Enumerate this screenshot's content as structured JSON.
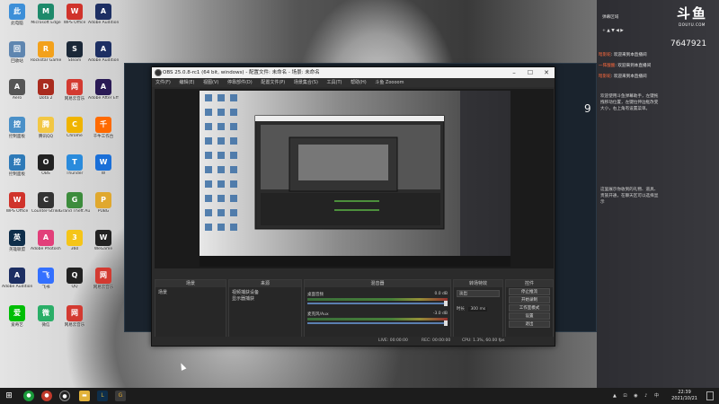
{
  "desktop_icons": [
    {
      "name": "此电脑",
      "icon": "computer-icon",
      "color": "#3d8fd8"
    },
    {
      "name": "Microsoft Edge",
      "icon": "edge-icon",
      "color": "#1e8a6b"
    },
    {
      "name": "WPS Office",
      "icon": "wps-icon",
      "color": "#d0332b"
    },
    {
      "name": "Adobe Audition",
      "icon": "audition-icon",
      "color": "#1d2f63"
    },
    {
      "name": "回收站",
      "icon": "recycle-bin-icon",
      "color": "#5f86b0"
    },
    {
      "name": "Rockstar Games",
      "icon": "rockstar-icon",
      "color": "#f3a11b"
    },
    {
      "name": "Steam",
      "icon": "steam-icon",
      "color": "#1b2838"
    },
    {
      "name": "Adobe Audition",
      "icon": "audition-icon",
      "color": "#1d2f63"
    },
    {
      "name": "Aero",
      "icon": "aero-icon",
      "color": "#555"
    },
    {
      "name": "Dota 2",
      "icon": "dota-icon",
      "color": "#a92b1e"
    },
    {
      "name": "网易云音乐",
      "icon": "music-icon",
      "color": "#d33a31"
    },
    {
      "name": "Adobe After Effects",
      "icon": "ae-icon",
      "color": "#2a1a55"
    },
    {
      "name": "控制面板",
      "icon": "control-panel-icon",
      "color": "#4a90c8"
    },
    {
      "name": "腾讯QQ",
      "icon": "qq-icon",
      "color": "#f2c744"
    },
    {
      "name": "Chrome",
      "icon": "chrome-icon",
      "color": "#f0b400"
    },
    {
      "name": "千牛工作台",
      "icon": "qianniu-icon",
      "color": "#ff6a00"
    },
    {
      "name": "控制面板",
      "icon": "keyboard-icon",
      "color": "#2e7ab8"
    },
    {
      "name": "OBS",
      "icon": "obs-icon",
      "color": "#222"
    },
    {
      "name": "Thunder",
      "icon": "thunder-icon",
      "color": "#2a8bdc"
    },
    {
      "name": "W",
      "icon": "wps-w-icon",
      "color": "#1a6fd8"
    },
    {
      "name": "WPS Office",
      "icon": "wps-icon",
      "color": "#d0332b"
    },
    {
      "name": "Counter-Strike",
      "icon": "cs-icon",
      "color": "#333"
    },
    {
      "name": "Grand Theft Auto V",
      "icon": "gta-icon",
      "color": "#3c8c3c"
    },
    {
      "name": "PUBG",
      "icon": "pubg-icon",
      "color": "#e0a82e"
    },
    {
      "name": "英雄联盟",
      "icon": "lol-icon",
      "color": "#0e2e4a"
    },
    {
      "name": "Adobe Photoshop",
      "icon": "photoshop-icon",
      "color": "#e23f7a"
    },
    {
      "name": "360",
      "icon": "360-icon",
      "color": "#f5c518"
    },
    {
      "name": "WeGame",
      "icon": "wegame-icon",
      "color": "#222"
    },
    {
      "name": "Adobe Audition",
      "icon": "audition-icon",
      "color": "#1d2f63"
    },
    {
      "name": "飞书",
      "icon": "feishu-icon",
      "color": "#3370ff"
    },
    {
      "name": "QQ",
      "icon": "qq-penguin-icon",
      "color": "#222"
    },
    {
      "name": "网易云音乐",
      "icon": "music-icon",
      "color": "#d33a31"
    },
    {
      "name": "爱奇艺",
      "icon": "iqiyi-icon",
      "color": "#00be06"
    },
    {
      "name": "微信",
      "icon": "wechat-icon",
      "color": "#2aae67"
    },
    {
      "name": "网易云音乐",
      "icon": "music-icon",
      "color": "#d33a31"
    }
  ],
  "sidebar": {
    "header": "弹幕区域",
    "follow_count": "7647921",
    "chat": [
      {
        "nick": "暗影蛇",
        "msg": "欢迎来到本直播间"
      },
      {
        "nick": "一阵酸酸",
        "msg": "欢迎来到本直播间"
      },
      {
        "nick": "暗影蛇",
        "msg": "欢迎来到本直播间"
      }
    ],
    "notice_1": "欢迎使用斗鱼弹幕助手，左键拖拽移动位置，左键拉伸边框改变大小，右上角有设置菜单。",
    "notice_2": "这里展示你收到的礼物、道具、贵族开通，在聊天区可以选择显示",
    "time_right": "9"
  },
  "obs": {
    "title": "OBS 25.0.8-rc1 (64 bit, windows) - 配置文件: 未命名 - 场景: 未命名",
    "menu": [
      "文件(F)",
      "编辑(E)",
      "视图(V)",
      "停靠部件(D)",
      "配置文件(P)",
      "场景集合(S)",
      "工具(T)",
      "帮助(H)",
      "斗鱼 Zoooom"
    ],
    "docks": {
      "scenes": {
        "title": "场景",
        "items": [
          "场景"
        ]
      },
      "sources": {
        "title": "来源",
        "items": [
          "视频捕获设备",
          "显示器捕获"
        ]
      },
      "mixer": {
        "title": "混音器",
        "rows": [
          {
            "name": "桌面音频",
            "db": "0.0 dB"
          },
          {
            "name": "麦克风/Aux",
            "db": "-3.0 dB"
          }
        ]
      },
      "transitions": {
        "title": "转场特效",
        "type": "淡出",
        "duration_label": "时长",
        "duration": "300 ms"
      },
      "controls": {
        "title": "控件",
        "buttons": [
          "停止推流",
          "开始录制",
          "工作室模式",
          "设置",
          "退出"
        ]
      }
    },
    "status": {
      "live": "LIVE: 00:00:00",
      "rec": "REC: 00:00:00",
      "cpu": "CPU: 1.3%, 60.00 fps"
    }
  },
  "taskbar": {
    "time": "22:39",
    "date": "2021/10/21"
  }
}
